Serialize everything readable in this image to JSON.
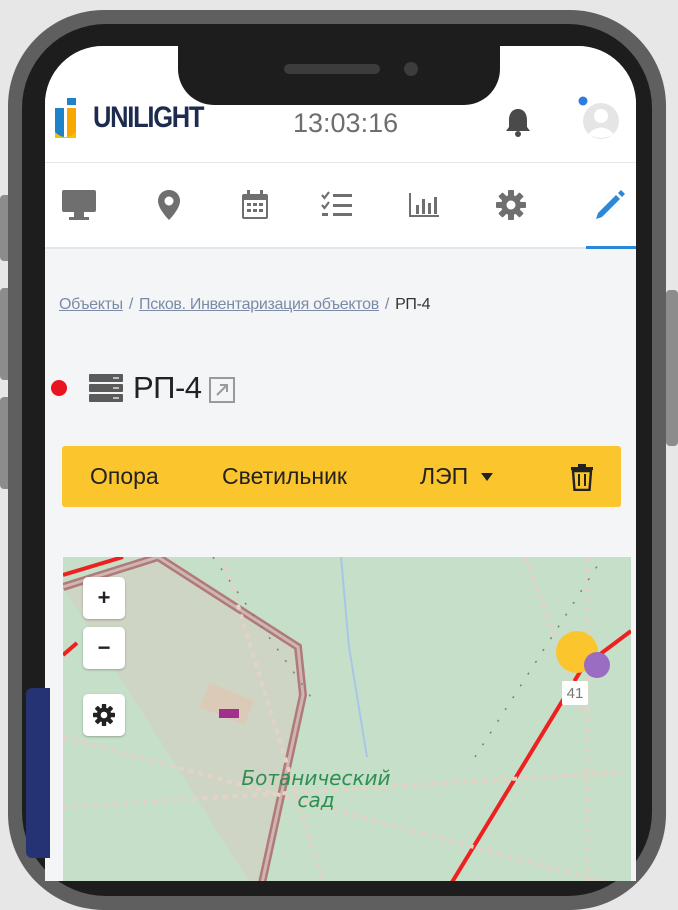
{
  "app": {
    "brand": "UNILIGHT",
    "clock": "13:03:16"
  },
  "colors": {
    "brand_blue": "#1c2b4e",
    "accent_blue": "#2b87d8",
    "toolbar_yellow": "#fbc52d",
    "status_red": "#e8141f",
    "map_green": "#c5dfc9",
    "line_red": "#ee2020"
  },
  "nav": {
    "items": [
      {
        "icon": "monitor-icon"
      },
      {
        "icon": "map-marker-icon"
      },
      {
        "icon": "calendar-icon"
      },
      {
        "icon": "checklist-icon"
      },
      {
        "icon": "bar-chart-icon"
      },
      {
        "icon": "gear-icon"
      },
      {
        "icon": "pencil-icon",
        "active": true
      }
    ]
  },
  "breadcrumb": {
    "items": [
      "Объекты",
      "Псков. Инвентаризация объектов"
    ],
    "separator": "/",
    "current": "РП-4"
  },
  "object": {
    "title": "РП-4",
    "status_icon": "status-dot-icon",
    "type_icon": "server-icon",
    "link_icon": "external-link-icon"
  },
  "toolbar": {
    "item1": "Опора",
    "item2": "Светильник",
    "item3": "ЛЭП",
    "delete_icon": "trash-icon"
  },
  "map": {
    "zoom_in": "+",
    "zoom_out": "−",
    "label_line1": "Ботанический",
    "label_line2": "сад",
    "house_number": "41"
  }
}
